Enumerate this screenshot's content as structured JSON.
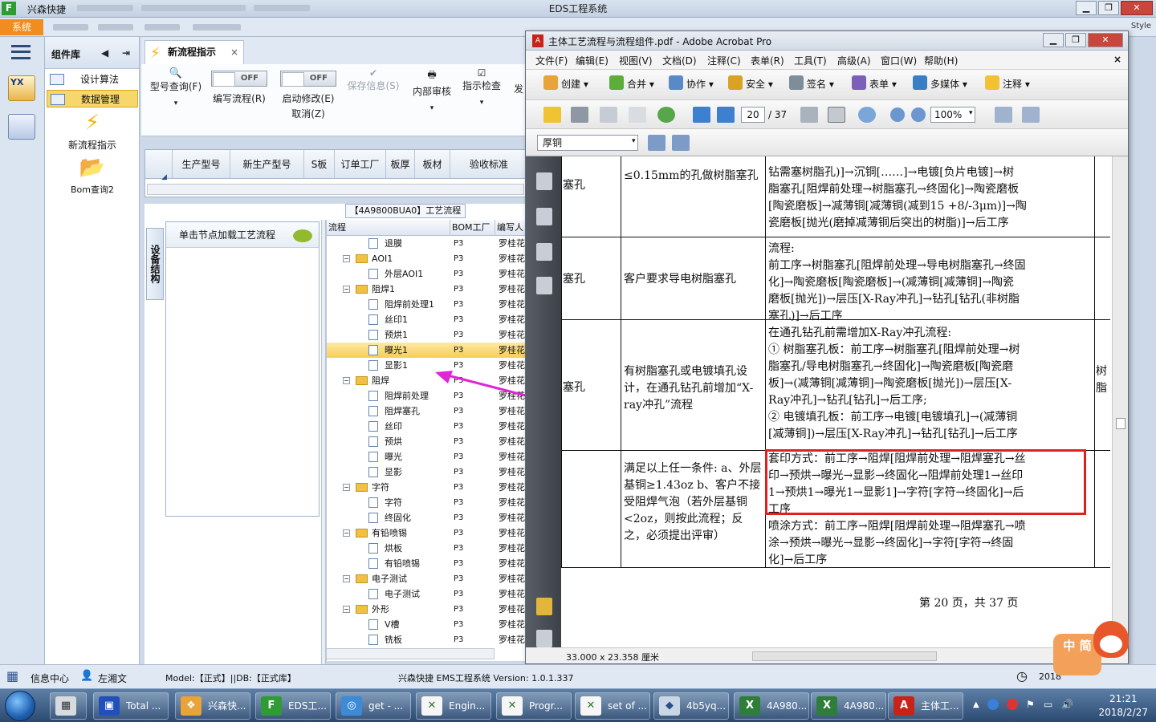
{
  "window": {
    "title": "EDS工程系统",
    "app_name": "兴森快捷",
    "logo": "F",
    "style_label": "Style"
  },
  "menu": {
    "system_tab": "系统"
  },
  "rail": {
    "yx": "YX"
  },
  "library": {
    "header": "组件库",
    "items": [
      {
        "label": "设计算法"
      },
      {
        "label": "数据管理"
      }
    ],
    "tools": [
      {
        "label": "新流程指示"
      },
      {
        "label": "Bom查询2"
      }
    ]
  },
  "doc_tab": {
    "label": "新流程指示",
    "close": "×"
  },
  "toolbar": {
    "model_query": "型号查询(F)",
    "edit_flow": "编写流程(R)",
    "start_modify": "启动修改(E)",
    "cancel": "取消(Z)",
    "save_info": "保存信息(S)",
    "internal_review": "内部审核",
    "instruction_check": "指示检查",
    "send": "发",
    "toggle_off": "OFF"
  },
  "grid": {
    "columns": [
      "生产型号",
      "新生产型号",
      "S板",
      "订单工厂",
      "板厚",
      "板材",
      "验收标准"
    ]
  },
  "process": {
    "title": "【4A9800BUA0】工艺流程",
    "vtab": "设备结构",
    "node_caption": "单击节点加载工艺流程",
    "tree_headers": [
      "流程",
      "BOM工厂",
      "编写人"
    ],
    "rows": [
      {
        "name": "退膜",
        "level": 2,
        "kind": "file",
        "bom": "P3",
        "author": "罗桂花"
      },
      {
        "name": "AOI1",
        "level": 1,
        "kind": "folder",
        "bom": "P3",
        "author": "罗桂花"
      },
      {
        "name": "外层AOI1",
        "level": 2,
        "kind": "file",
        "bom": "P3",
        "author": "罗桂花"
      },
      {
        "name": "阻焊1",
        "level": 1,
        "kind": "folder",
        "bom": "P3",
        "author": "罗桂花"
      },
      {
        "name": "阻焊前处理1",
        "level": 2,
        "kind": "file",
        "bom": "P3",
        "author": "罗桂花"
      },
      {
        "name": "丝印1",
        "level": 2,
        "kind": "file",
        "bom": "P3",
        "author": "罗桂花"
      },
      {
        "name": "预烘1",
        "level": 2,
        "kind": "file",
        "bom": "P3",
        "author": "罗桂花"
      },
      {
        "name": "曝光1",
        "level": 2,
        "kind": "file",
        "bom": "P3",
        "author": "罗桂花",
        "selected": true
      },
      {
        "name": "显影1",
        "level": 2,
        "kind": "file",
        "bom": "P3",
        "author": "罗桂花"
      },
      {
        "name": "阻焊",
        "level": 1,
        "kind": "folder",
        "bom": "P3",
        "author": "罗桂花"
      },
      {
        "name": "阻焊前处理",
        "level": 2,
        "kind": "file",
        "bom": "P3",
        "author": "罗桂花"
      },
      {
        "name": "阻焊塞孔",
        "level": 2,
        "kind": "file",
        "bom": "P3",
        "author": "罗桂花"
      },
      {
        "name": "丝印",
        "level": 2,
        "kind": "file",
        "bom": "P3",
        "author": "罗桂花"
      },
      {
        "name": "预烘",
        "level": 2,
        "kind": "file",
        "bom": "P3",
        "author": "罗桂花"
      },
      {
        "name": "曝光",
        "level": 2,
        "kind": "file",
        "bom": "P3",
        "author": "罗桂花"
      },
      {
        "name": "显影",
        "level": 2,
        "kind": "file",
        "bom": "P3",
        "author": "罗桂花"
      },
      {
        "name": "字符",
        "level": 1,
        "kind": "folder",
        "bom": "P3",
        "author": "罗桂花"
      },
      {
        "name": "字符",
        "level": 2,
        "kind": "file",
        "bom": "P3",
        "author": "罗桂花"
      },
      {
        "name": "终固化",
        "level": 2,
        "kind": "file",
        "bom": "P3",
        "author": "罗桂花"
      },
      {
        "name": "有铅喷锡",
        "level": 1,
        "kind": "folder",
        "bom": "P3",
        "author": "罗桂花"
      },
      {
        "name": "烘板",
        "level": 2,
        "kind": "file",
        "bom": "P3",
        "author": "罗桂花"
      },
      {
        "name": "有铅喷锡",
        "level": 2,
        "kind": "file",
        "bom": "P3",
        "author": "罗桂花"
      },
      {
        "name": "电子测试",
        "level": 1,
        "kind": "folder",
        "bom": "P3",
        "author": "罗桂花"
      },
      {
        "name": "电子测试",
        "level": 2,
        "kind": "file",
        "bom": "P3",
        "author": "罗桂花"
      },
      {
        "name": "外形",
        "level": 1,
        "kind": "folder",
        "bom": "P3",
        "author": "罗桂花"
      },
      {
        "name": "V槽",
        "level": 2,
        "kind": "file",
        "bom": "P3",
        "author": "罗桂花"
      },
      {
        "name": "铣板",
        "level": 2,
        "kind": "file",
        "bom": "P3",
        "author": "罗桂花"
      }
    ]
  },
  "acrobat": {
    "title": "主体工艺流程与流程组件.pdf - Adobe Acrobat Pro",
    "menu": [
      "文件(F)",
      "编辑(E)",
      "视图(V)",
      "文档(D)",
      "注释(C)",
      "表单(R)",
      "工具(T)",
      "高级(A)",
      "窗口(W)",
      "帮助(H)"
    ],
    "close_x": "×",
    "toolbar": [
      "创建",
      "合并",
      "协作",
      "安全",
      "签名",
      "表单",
      "多媒体",
      "注释"
    ],
    "page_current": "20",
    "page_total": "/ 37",
    "zoom": "100%",
    "search": "厚铜",
    "status_size": "33.000 x 23.358 厘米",
    "page": {
      "rows": [
        {
          "c1": "塞孔",
          "c2": "≤0.15mm的孔做树脂塞孔",
          "c3": [
            "钻需塞树脂孔)]→沉铜[……]→电镀[负片电镀]→树",
            "脂塞孔[阻焊前处理→树脂塞孔→终固化]→陶瓷磨板",
            "[陶瓷磨板]→减薄铜[减薄铜(减到15 +8/-3μm)]→陶",
            "瓷磨板[抛光(磨掉减薄铜后突出的树脂)]→后工序"
          ]
        },
        {
          "c1": "塞孔",
          "c2": "客户要求导电树脂塞孔",
          "c3": [
            "流程:",
            "前工序→树脂塞孔[阻焊前处理→导电树脂塞孔→终固",
            "化]→陶瓷磨板[陶瓷磨板]→(减薄铜[减薄铜]→陶瓷",
            "磨板[抛光])→层压[X-Ray冲孔]→钻孔[钻孔(非树脂",
            "塞孔)]→后工序"
          ]
        },
        {
          "c1": "塞孔",
          "c2": "有树脂塞孔或电镀填孔设计，在通孔钻孔前增加“X-ray冲孔”流程",
          "c3": [
            "在通孔钻孔前需增加X-Ray冲孔流程:",
            "① 树脂塞孔板：前工序→树脂塞孔[阻焊前处理→树",
            "脂塞孔/导电树脂塞孔→终固化]→陶瓷磨板[陶瓷磨",
            "板]→(减薄铜[减薄铜]→陶瓷磨板[抛光])→层压[X-",
            "Ray冲孔]→钻孔[钻孔]→后工序;",
            "② 电镀填孔板：前工序→电镀[电镀填孔]→(减薄铜",
            "[减薄铜])→层压[X-Ray冲孔]→钻孔[钻孔]→后工序"
          ],
          "c4": "树脂"
        },
        {
          "c1": "",
          "c2": "满足以上任一条件: a、外层基铜≥1.43oz b、客户不接受阻焊气泡（若外层基铜<2oz，则按此流程；反之，必须提出评审）",
          "c3": [
            "套印方式：前工序→阻焊[阻焊前处理→阻焊塞孔→丝",
            "印→预烘→曝光→显影→终固化→阻焊前处理1→丝印",
            "1→预烘1→曝光1→显影1]→字符[字符→终固化]→后",
            "工序",
            "喷涂方式：前工序→阻焊[阻焊前处理→阻焊塞孔→喷",
            "涂→预烘→曝光→显影→终固化]→字符[字符→终固",
            "化]→后工序"
          ]
        }
      ],
      "footer": "第 20 页，共 37 页"
    }
  },
  "statusbar": {
    "info_center": "信息中心",
    "user": "左湘文",
    "model": "Model:【正式】||DB:【正式库】",
    "system": "兴森快捷 EMS工程系统  Version: 1.0.1.337",
    "year_partial": "2018"
  },
  "taskbar": {
    "items": [
      "Total ...",
      "兴森快...",
      "EDS工...",
      "get - ...",
      "Engin...",
      "Progr...",
      "set of ...",
      "4b5yq...",
      "4A980...",
      "4A980...",
      "主体工..."
    ],
    "time": "21:21",
    "date": "2018/2/27"
  },
  "mascot": {
    "text": "中 简"
  },
  "colors": {
    "accent_orange": "#f28c1e",
    "highlight_red": "#e0201e",
    "arrow_magenta": "#e024d8",
    "selected_row": "#f7cd55"
  }
}
